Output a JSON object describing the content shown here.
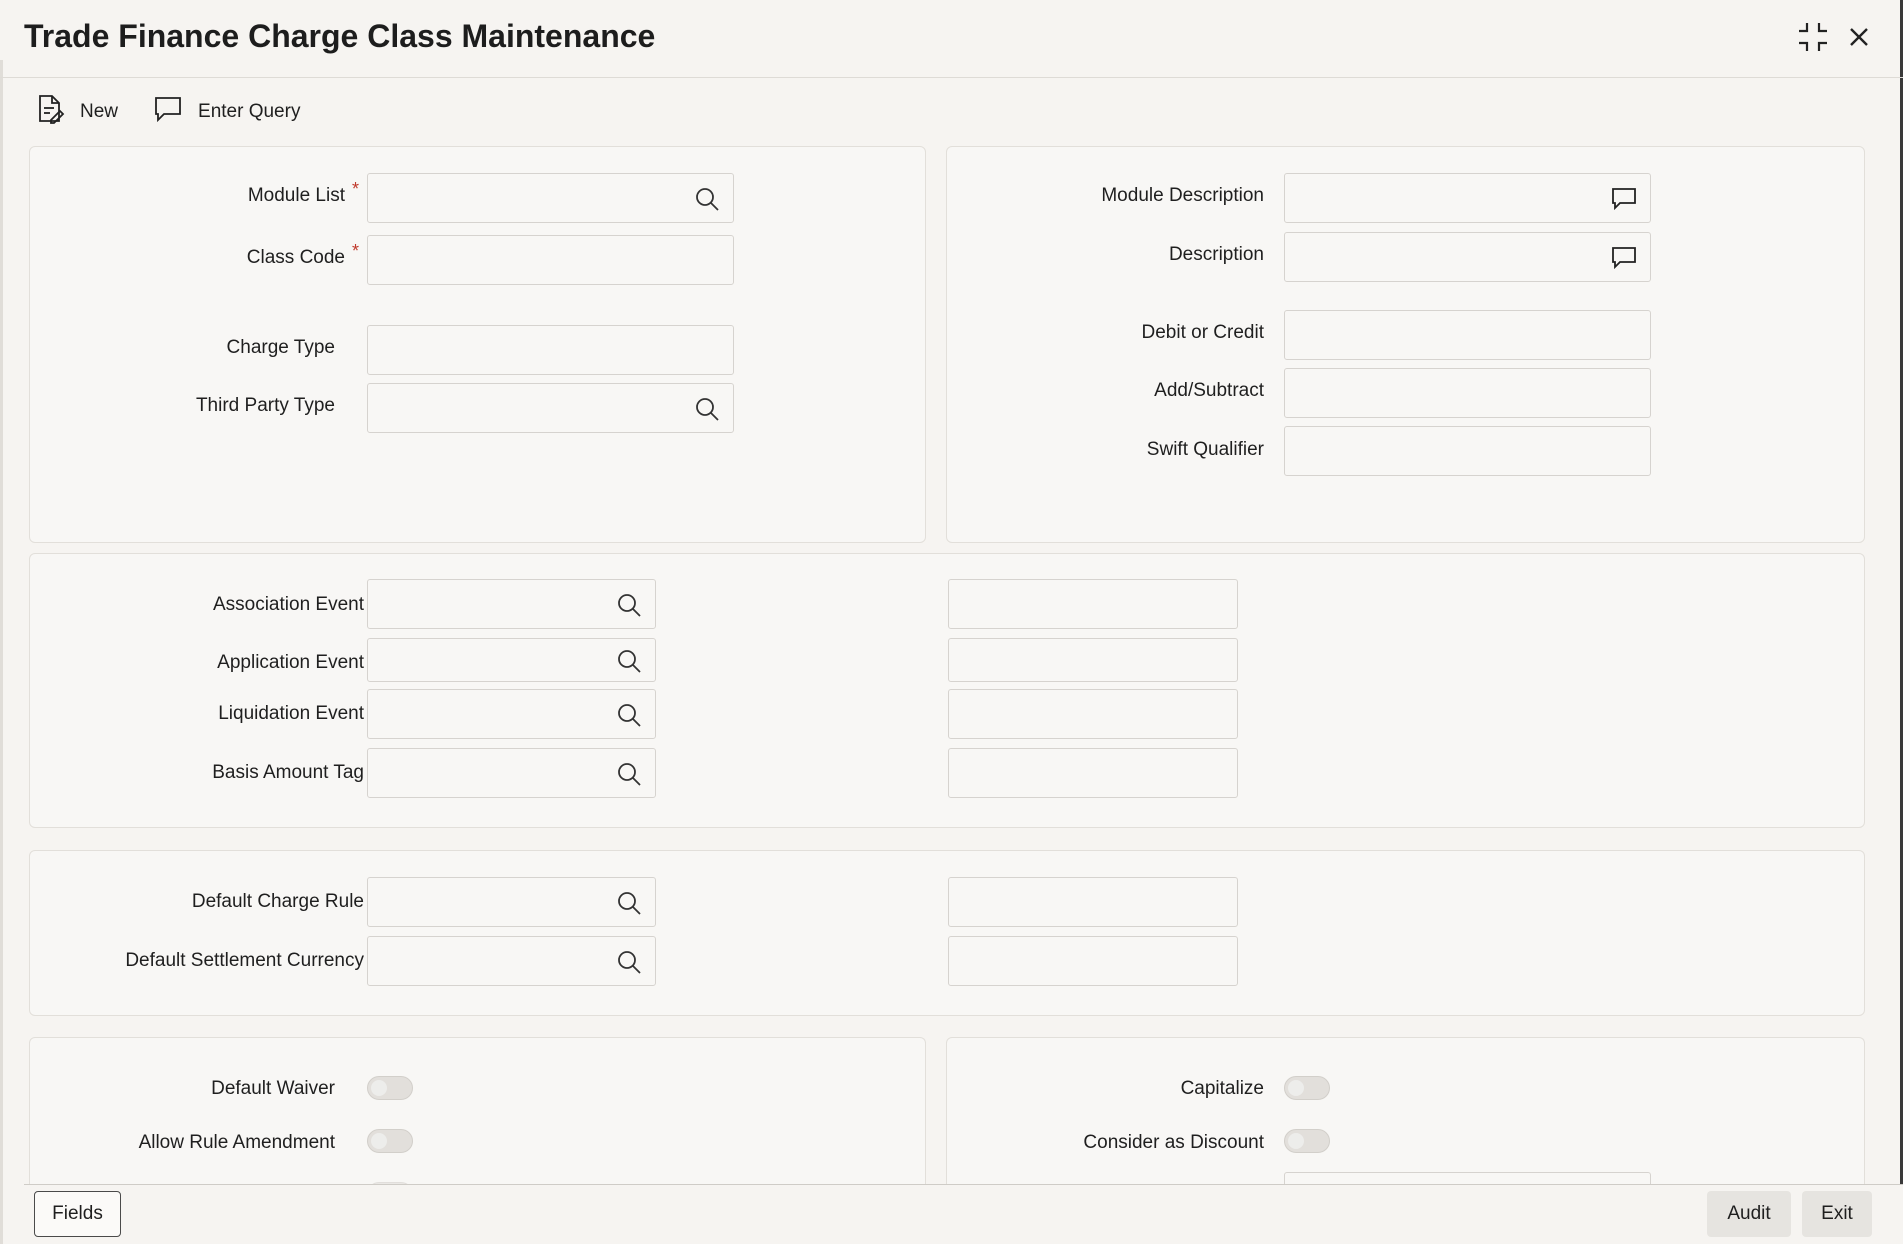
{
  "window": {
    "title": "Trade Finance Charge Class Maintenance"
  },
  "toolbar": {
    "new_label": "New",
    "enter_query_label": "Enter Query"
  },
  "header_left": {
    "module_list_label": "Module List",
    "class_code_label": "Class Code",
    "charge_type_label": "Charge Type",
    "third_party_type_label": "Third Party Type",
    "required_marker": "*"
  },
  "header_right": {
    "module_description_label": "Module Description",
    "description_label": "Description",
    "debit_or_credit_label": "Debit or Credit",
    "add_subtract_label": "Add/Subtract",
    "swift_qualifier_label": "Swift Qualifier"
  },
  "events": {
    "association_event_label": "Association Event",
    "application_event_label": "Application Event",
    "liquidation_event_label": "Liquidation Event",
    "basis_amount_tag_label": "Basis Amount Tag"
  },
  "defaults": {
    "default_charge_rule_label": "Default Charge Rule",
    "default_settlement_currency_label": "Default Settlement Currency"
  },
  "flags_left": {
    "default_waiver_label": "Default Waiver",
    "default_waiver_value": false,
    "allow_rule_amendment_label": "Allow Rule Amendment",
    "allow_rule_amendment_value": false
  },
  "flags_right": {
    "capitalize_label": "Capitalize",
    "capitalize_value": false,
    "consider_as_discount_label": "Consider as Discount",
    "consider_as_discount_value": false
  },
  "footer": {
    "fields_label": "Fields",
    "audit_label": "Audit",
    "exit_label": "Exit"
  },
  "icons": {
    "search": "search-icon",
    "comment": "comment-icon",
    "new": "new-document-icon",
    "enter_query": "enter-query-icon",
    "minimize": "minimize-icon",
    "close": "close-icon"
  }
}
